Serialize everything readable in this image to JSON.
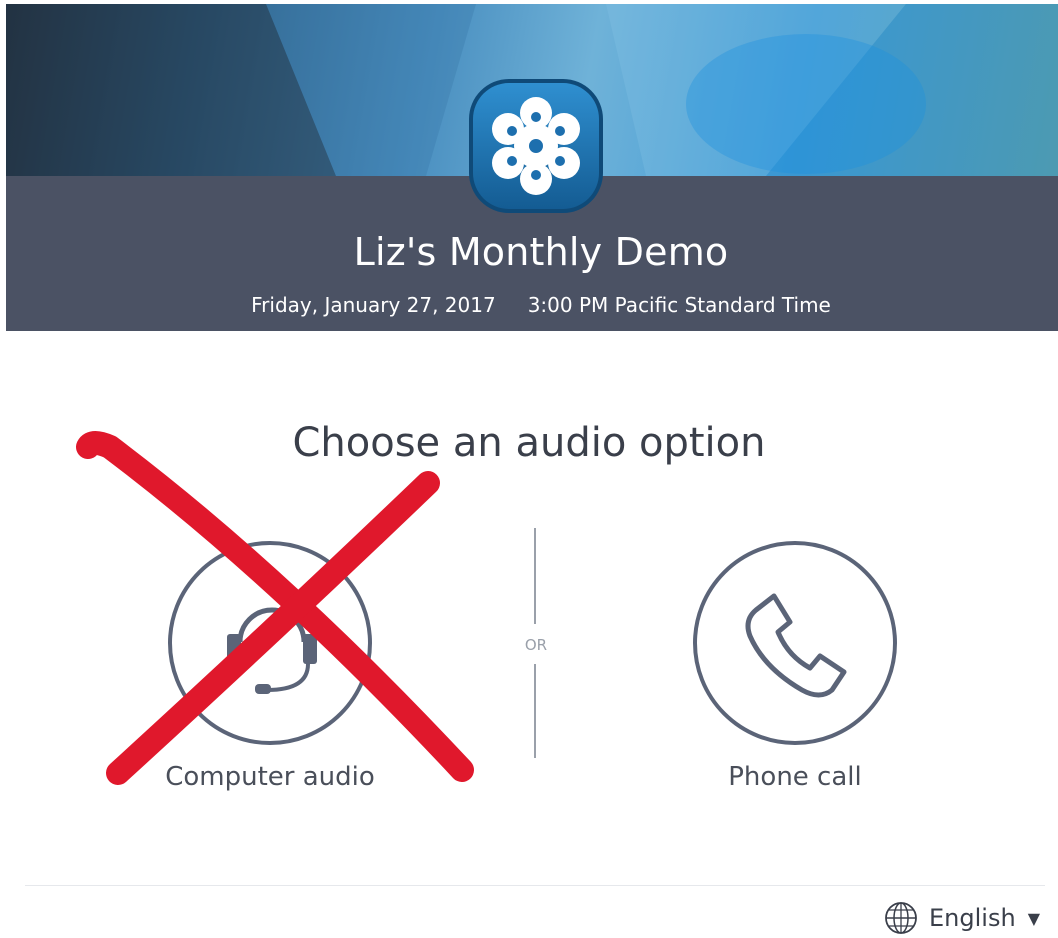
{
  "meeting": {
    "title": "Liz's Monthly Demo",
    "date": "Friday, January 27, 2017",
    "time": "3:00 PM Pacific Standard Time"
  },
  "audio": {
    "heading": "Choose an audio option",
    "separator": "OR",
    "computer_label": "Computer audio",
    "phone_label": "Phone call"
  },
  "language": {
    "selected": "English"
  },
  "colors": {
    "band": "#4b5264",
    "outline": "#5b6478",
    "cross": "#e0182c"
  },
  "icons": {
    "logo": "flower-logo-icon",
    "computer": "headset-icon",
    "phone": "phone-handset-icon",
    "language": "globe-icon",
    "dropdown": "caret-down-icon"
  }
}
